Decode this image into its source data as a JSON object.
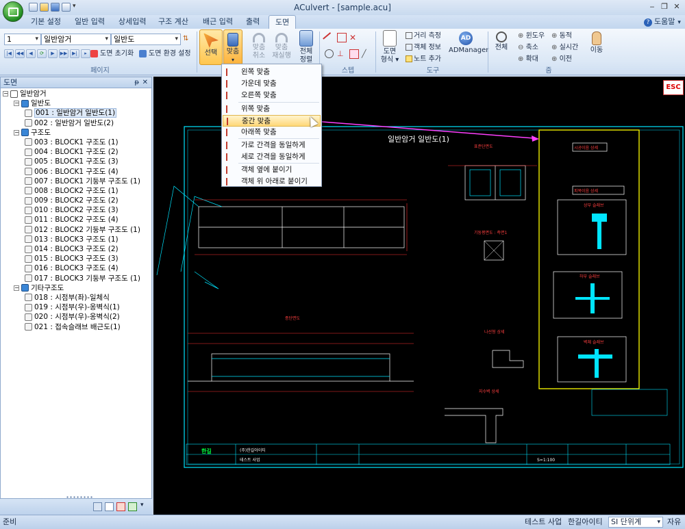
{
  "app": {
    "title": "ACulvert - [sample.acu]"
  },
  "window_controls": {
    "minimize": "‒",
    "restore": "❐",
    "close": "✕"
  },
  "tabs": [
    {
      "label": "기본 설정"
    },
    {
      "label": "일반 입력"
    },
    {
      "label": "상세입력"
    },
    {
      "label": "구조 계산"
    },
    {
      "label": "배근 입력"
    },
    {
      "label": "출력"
    },
    {
      "label": "도면"
    }
  ],
  "active_tab": "도면",
  "help": {
    "label": "도움말"
  },
  "ribbon": {
    "page_group": {
      "combo1_value": "1",
      "combo2_value": "일반암거",
      "combo3_value": "일반도",
      "reset_label": "도면 초기화",
      "env_label": "도면 환경 설정",
      "group_label": "페이지"
    },
    "edit_group": {
      "select_label": "선택",
      "align_label": "맞춤",
      "undo_label_1": "맞춤",
      "undo_label_2": "취소",
      "redo_label_1": "맞춤",
      "redo_label_2": "재실행",
      "fit_label_1": "전체",
      "fit_label_2": "정렬"
    },
    "step_group": {
      "group_label": "스텝"
    },
    "tools_group": {
      "form_label_1": "도면",
      "form_label_2": "형식",
      "measure_label": "거리 측정",
      "objinfo_label": "객체 정보",
      "note_label": "노트 추가",
      "admanager_label": "ADManager",
      "group_label": "도구"
    },
    "zoom_group": {
      "all_label": "전체",
      "window_label": "윈도우",
      "zoomout_label": "축소",
      "zoomin_label": "확대",
      "dynamic_label": "동적",
      "realtime_label": "실시간",
      "prev_label": "이전",
      "pan_label": "이동",
      "group_label": "줌"
    }
  },
  "panel": {
    "title": "도면",
    "pin": "ᵽ",
    "close": "✕",
    "tree": [
      {
        "level": 0,
        "exp": "−",
        "icon": "root",
        "label": "일반암거"
      },
      {
        "level": 1,
        "exp": "−",
        "icon": "grp",
        "label": "일반도"
      },
      {
        "level": 2,
        "icon": "doc",
        "label": "001 : 일반암거 일반도(1)",
        "selected": true
      },
      {
        "level": 2,
        "icon": "doc",
        "label": "002 : 일반암거 일반도(2)"
      },
      {
        "level": 1,
        "exp": "−",
        "icon": "grp",
        "label": "구조도"
      },
      {
        "level": 2,
        "icon": "doc",
        "label": "003 : BLOCK1 구조도 (1)"
      },
      {
        "level": 2,
        "icon": "doc",
        "label": "004 : BLOCK1 구조도 (2)"
      },
      {
        "level": 2,
        "icon": "doc",
        "label": "005 : BLOCK1 구조도 (3)"
      },
      {
        "level": 2,
        "icon": "doc",
        "label": "006 : BLOCK1 구조도 (4)"
      },
      {
        "level": 2,
        "icon": "doc",
        "label": "007 : BLOCK1 기둥부 구조도 (1)"
      },
      {
        "level": 2,
        "icon": "doc",
        "label": "008 : BLOCK2 구조도 (1)"
      },
      {
        "level": 2,
        "icon": "doc",
        "label": "009 : BLOCK2 구조도 (2)"
      },
      {
        "level": 2,
        "icon": "doc",
        "label": "010 : BLOCK2 구조도 (3)"
      },
      {
        "level": 2,
        "icon": "doc",
        "label": "011 : BLOCK2 구조도 (4)"
      },
      {
        "level": 2,
        "icon": "doc",
        "label": "012 : BLOCK2 기둥부 구조도 (1)"
      },
      {
        "level": 2,
        "icon": "doc",
        "label": "013 : BLOCK3 구조도 (1)"
      },
      {
        "level": 2,
        "icon": "doc",
        "label": "014 : BLOCK3 구조도 (2)"
      },
      {
        "level": 2,
        "icon": "doc",
        "label": "015 : BLOCK3 구조도 (3)"
      },
      {
        "level": 2,
        "icon": "doc",
        "label": "016 : BLOCK3 구조도 (4)"
      },
      {
        "level": 2,
        "icon": "doc",
        "label": "017 : BLOCK3 기둥부 구조도 (1)"
      },
      {
        "level": 1,
        "exp": "−",
        "icon": "grp",
        "label": "기타구조도"
      },
      {
        "level": 2,
        "icon": "doc",
        "label": "018 : 시점부(좌)-일체식"
      },
      {
        "level": 2,
        "icon": "doc",
        "label": "019 : 시점부(우)-옹벽식(1)"
      },
      {
        "level": 2,
        "icon": "doc",
        "label": "020 : 시점부(우)-옹벽식(2)"
      },
      {
        "level": 2,
        "icon": "doc",
        "label": "021 : 접속슬래브 배근도(1)"
      }
    ]
  },
  "align_menu": [
    {
      "label": "왼쪽 맞춤"
    },
    {
      "label": "가운데 맞춤"
    },
    {
      "label": "오른쪽 맞춤"
    },
    {
      "label": "위쪽 맞춤"
    },
    {
      "label": "중간 맞춤",
      "hover": true
    },
    {
      "label": "아래쪽 맞춤"
    },
    {
      "label": "가로 간격을 동일하게"
    },
    {
      "label": "세로 간격을 동일하게"
    },
    {
      "label": "객체 옆에 붙이기"
    },
    {
      "label": "객체 위 아래로 붙이기"
    }
  ],
  "drawing": {
    "main_title": "일반암거 일반도(1)",
    "esc_label": "ESC",
    "views": [
      "표준단면도",
      "기둥평면도 : 측면1",
      "종단면도",
      "나선형 상세",
      "지수벽 상세",
      "시공이음 상세",
      "피복이음 상세",
      "상부 슬래브",
      "하부 슬래브",
      "벽체 슬래브"
    ],
    "title_block_company": "(주)한길아이티",
    "title_block_project": "테스트 사업",
    "title_block_scale": "S=1:100"
  },
  "statusbar": {
    "left": "준비",
    "project": "테스트 사업",
    "company": "한길아이티",
    "unit_label": "SI 단위계",
    "mode": "자유"
  }
}
